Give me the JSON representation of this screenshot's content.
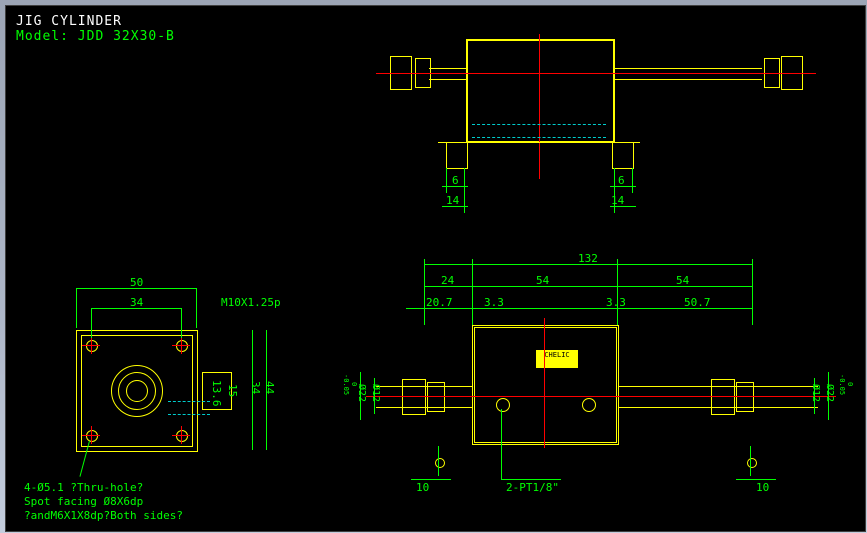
{
  "header": {
    "title": "JIG CYLINDER",
    "model": "Model: JDD 32X30-B"
  },
  "notes": {
    "line1": "4-Ø5.1 ?Thru-hole?",
    "line2": "Spot facing Ø8X6dp",
    "line3": "?andM6X1X8dp?Both sides?"
  },
  "labels": {
    "thread": "M10X1.25p",
    "port": "2-PT1/8\"",
    "brand": "CHELIC"
  },
  "dims": {
    "top_view": {
      "d6a": "6",
      "d6b": "6",
      "d14a": "14",
      "d14b": "14"
    },
    "left_view": {
      "d50": "50",
      "d34": "34",
      "d34v": "34",
      "d44": "44",
      "d15": "15",
      "d13_6": "13.6"
    },
    "right_view": {
      "d132": "132",
      "d24": "24",
      "d54a": "54",
      "d54b": "54",
      "d20_7": "20.7",
      "d3_3a": "3.3",
      "d3_3b": "3.3",
      "d50_7": "50.7",
      "d10a": "10",
      "d10b": "10",
      "dia22a": "Ø22",
      "dia12a": "Ø12",
      "dia22b": "Ø22",
      "dia12b": "Ø12",
      "tol": "-0.05"
    }
  }
}
